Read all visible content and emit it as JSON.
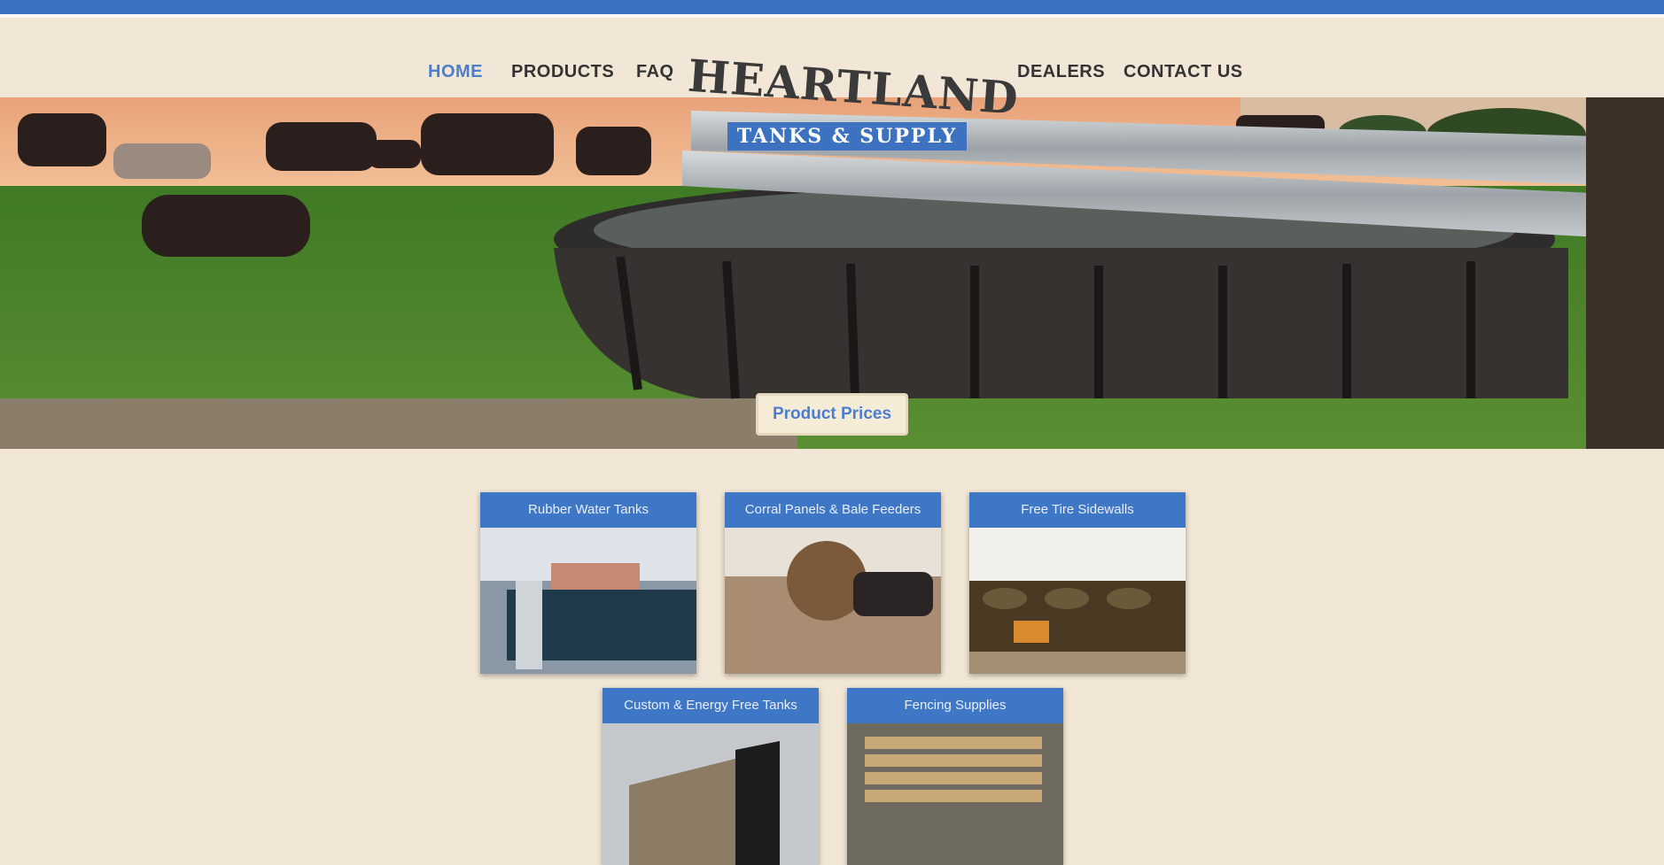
{
  "nav": {
    "items": [
      {
        "label": "HOME",
        "active": true
      },
      {
        "label": "PRODUCTS",
        "active": false
      },
      {
        "label": "FAQ",
        "active": false
      },
      {
        "label": "DEALERS",
        "active": false
      },
      {
        "label": "CONTACT US",
        "active": false
      }
    ]
  },
  "logo": {
    "title": "HEARTLAND",
    "subtitle": "TANKS & SUPPLY"
  },
  "hero": {
    "cta_label": "Product Prices"
  },
  "cards": [
    {
      "title": "Rubber Water Tanks"
    },
    {
      "title": "Corral Panels & Bale Feeders"
    },
    {
      "title": "Free Tire Sidewalls"
    },
    {
      "title": "Custom & Energy Free Tanks"
    },
    {
      "title": "Fencing Supplies"
    }
  ],
  "colors": {
    "brand_blue": "#3c72c0",
    "background": "#f2e7d6",
    "active_nav": "#4a7fd0"
  }
}
